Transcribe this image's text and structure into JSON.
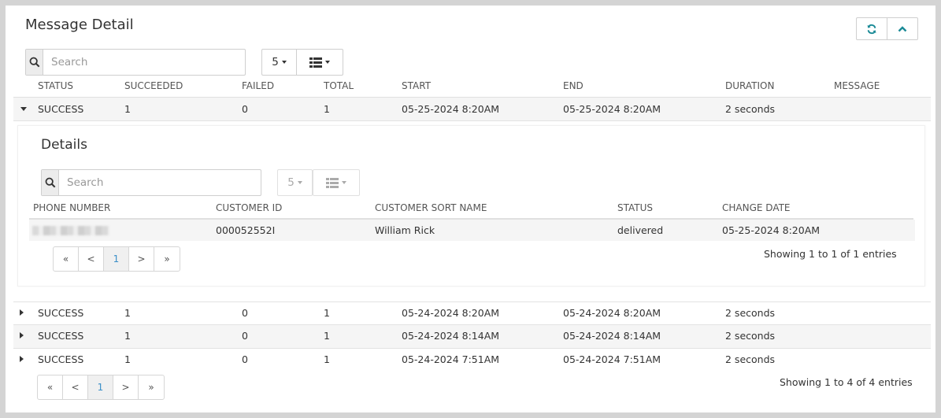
{
  "title": "Message Detail",
  "header_buttons": {
    "refresh_icon": "refresh-icon",
    "collapse_icon": "chevron-up-icon"
  },
  "toolbar": {
    "search_placeholder": "Search",
    "page_size": "5"
  },
  "columns": [
    "STATUS",
    "SUCCEEDED",
    "FAILED",
    "TOTAL",
    "START",
    "END",
    "DURATION",
    "MESSAGE"
  ],
  "rows": [
    {
      "status": "SUCCESS",
      "succeeded": "1",
      "failed": "0",
      "total": "1",
      "start": "05-25-2024 8:20AM",
      "end": "05-25-2024 8:20AM",
      "duration": "2 seconds",
      "message": "",
      "expanded": true
    },
    {
      "status": "SUCCESS",
      "succeeded": "1",
      "failed": "0",
      "total": "1",
      "start": "05-24-2024 8:20AM",
      "end": "05-24-2024 8:20AM",
      "duration": "2 seconds",
      "message": ""
    },
    {
      "status": "SUCCESS",
      "succeeded": "1",
      "failed": "0",
      "total": "1",
      "start": "05-24-2024 8:14AM",
      "end": "05-24-2024 8:14AM",
      "duration": "2 seconds",
      "message": ""
    },
    {
      "status": "SUCCESS",
      "succeeded": "1",
      "failed": "0",
      "total": "1",
      "start": "05-24-2024 7:51AM",
      "end": "05-24-2024 7:51AM",
      "duration": "2 seconds",
      "message": ""
    }
  ],
  "details": {
    "title": "Details",
    "search_placeholder": "Search",
    "page_size": "5",
    "columns": [
      "PHONE NUMBER",
      "CUSTOMER ID",
      "CUSTOMER SORT NAME",
      "STATUS",
      "CHANGE DATE"
    ],
    "rows": [
      {
        "customer_id": "000052552I",
        "customer_sort_name": "William Rick",
        "status": "delivered",
        "change_date": "05-25-2024 8:20AM"
      }
    ],
    "pager": {
      "first": "«",
      "prev": "<",
      "page": "1",
      "next": ">",
      "last": "»"
    },
    "info": "Showing 1 to 1 of 1 entries"
  },
  "pager": {
    "first": "«",
    "prev": "<",
    "page": "1",
    "next": ">",
    "last": "»"
  },
  "info": "Showing 1 to 4 of 4 entries",
  "colors": {
    "accent": "#1a8a96",
    "active_page": "#3a8fc8",
    "row_bg": "#f5f5f5"
  }
}
